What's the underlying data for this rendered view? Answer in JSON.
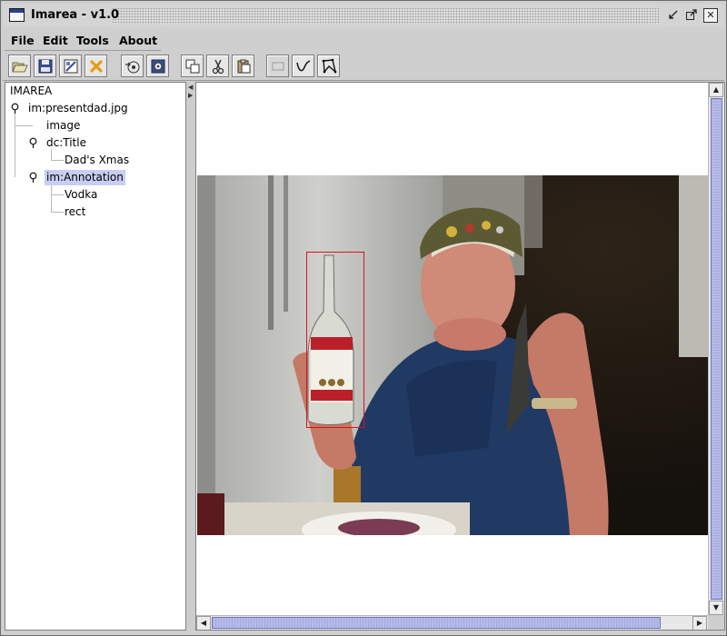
{
  "window": {
    "title": "Imarea - v1.0"
  },
  "menu": {
    "items": [
      "File",
      "Edit",
      "Tools",
      "About"
    ]
  },
  "toolbar": {
    "buttons": [
      {
        "name": "open-button",
        "icon": "folder-open-icon"
      },
      {
        "name": "save-button",
        "icon": "floppy-disk-icon"
      },
      {
        "name": "image-properties-button",
        "icon": "image-document-icon"
      },
      {
        "name": "close-file-button",
        "icon": "x-close-icon"
      },
      {
        "name": "load-annotations-button",
        "icon": "load-disk-icon"
      },
      {
        "name": "save-annotations-button",
        "icon": "disk-settings-icon"
      },
      {
        "name": "copy-button",
        "icon": "copy-icon"
      },
      {
        "name": "cut-button",
        "icon": "scissors-icon"
      },
      {
        "name": "paste-button",
        "icon": "paste-icon"
      },
      {
        "name": "rectangle-tool-button",
        "icon": "rectangle-icon"
      },
      {
        "name": "curve-tool-button",
        "icon": "curve-icon"
      },
      {
        "name": "polygon-tool-button",
        "icon": "polygon-icon"
      }
    ]
  },
  "tree": {
    "root": "IMAREA",
    "file": "im:presentdad.jpg",
    "image": "image",
    "title_node": "dc:Title",
    "title_value": "Dad's Xmas",
    "annotation_node": "im:Annotation",
    "annotation_label": "Vodka",
    "annotation_shape": "rect"
  },
  "colors": {
    "selection": "#c9cdf2",
    "annotation_rect": "#d6121e",
    "scroll_thumb": "#b7bbe8"
  }
}
